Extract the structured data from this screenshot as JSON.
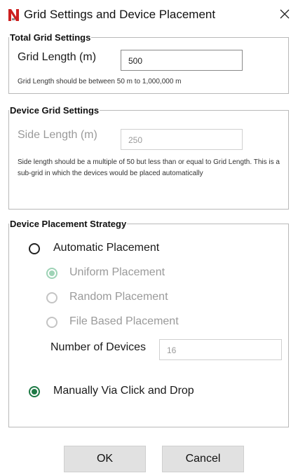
{
  "window": {
    "title": "Grid Settings and Device Placement",
    "close_glyph": "✕",
    "icon": "app-logo-icon"
  },
  "total_grid": {
    "legend": "Total Grid Settings",
    "label": "Grid Length (m)",
    "value": "500",
    "hint": "Grid Length should be between 50 m to 1,000,000 m"
  },
  "device_grid": {
    "legend": "Device Grid Settings",
    "label": "Side Length (m)",
    "value": "250",
    "hint": "Side length should be a multiple of 50 but less than or equal to Grid Length. This is a sub-grid in which the devices would be placed automatically"
  },
  "placement": {
    "legend": "Device Placement Strategy",
    "automatic": {
      "label": "Automatic Placement",
      "checked": false
    },
    "uniform": {
      "label": "Uniform Placement",
      "checked": true,
      "enabled": false
    },
    "random": {
      "label": "Random Placement",
      "checked": false,
      "enabled": false
    },
    "file_based": {
      "label": "File Based Placement",
      "checked": false,
      "enabled": false
    },
    "num_devices_label": "Number of Devices",
    "num_devices_value": "16",
    "manual": {
      "label": "Manually Via Click and Drop",
      "checked": true
    }
  },
  "buttons": {
    "ok": "OK",
    "cancel": "Cancel"
  },
  "colors": {
    "accent_green": "#1e7a45",
    "logo_red": "#cc1f1f",
    "button_bg": "#e1e1e1"
  }
}
